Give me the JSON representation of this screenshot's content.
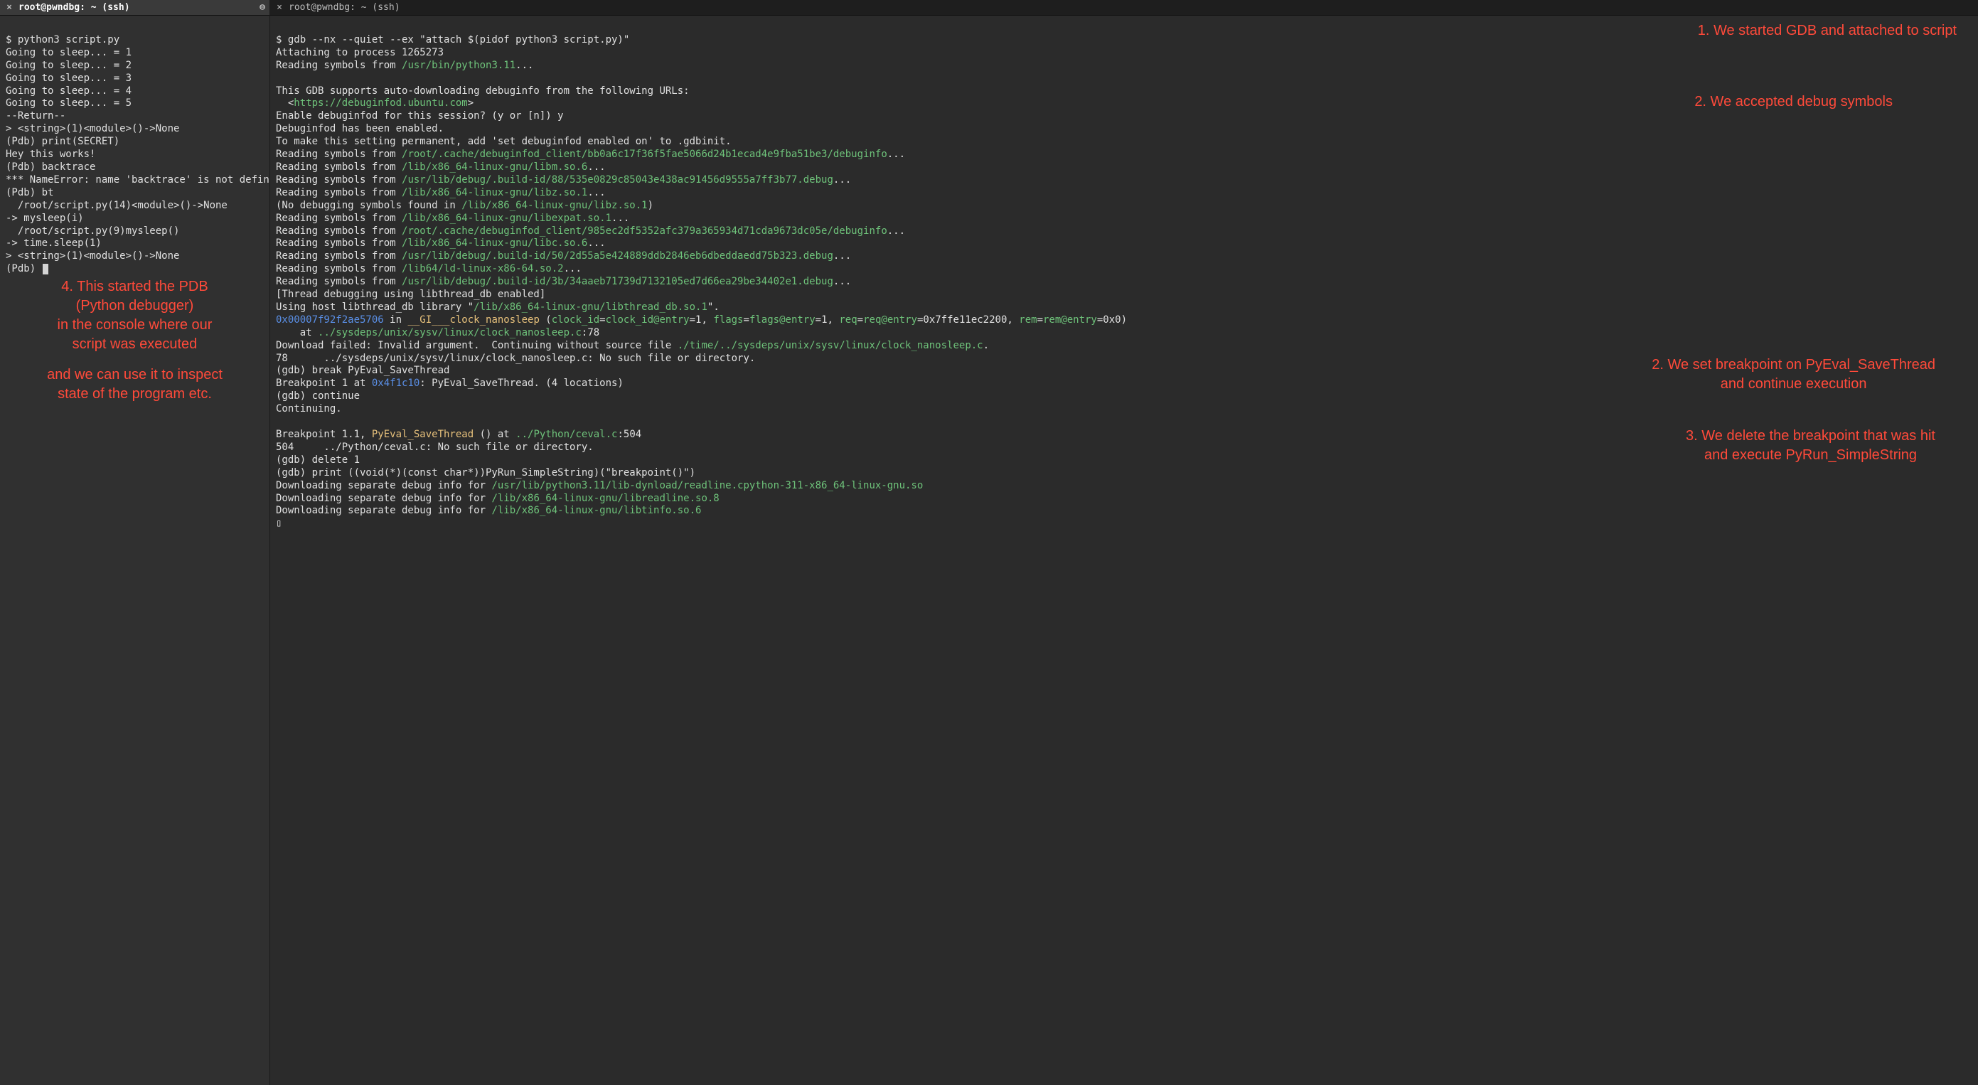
{
  "tabs": {
    "left": {
      "title": "root@pwndbg: ~ (ssh)",
      "close_glyph": "×",
      "extra_glyph": "⊖"
    },
    "right": {
      "title": "root@pwndbg: ~ (ssh)",
      "close_glyph": "×"
    }
  },
  "left_term": {
    "l01": "$ python3 script.py",
    "l02": "Going to sleep... = 1",
    "l03": "Going to sleep... = 2",
    "l04": "Going to sleep... = 3",
    "l05": "Going to sleep... = 4",
    "l06": "Going to sleep... = 5",
    "l07": "--Return--",
    "l08": "> <string>(1)<module>()->None",
    "l09": "(Pdb) print(SECRET)",
    "l10": "Hey this works!",
    "l11": "(Pdb) backtrace",
    "l12": "*** NameError: name 'backtrace' is not defined",
    "l13": "(Pdb) bt",
    "l14": "  /root/script.py(14)<module>()->None",
    "l15": "-> mysleep(i)",
    "l16": "  /root/script.py(9)mysleep()",
    "l17": "-> time.sleep(1)",
    "l18": "> <string>(1)<module>()->None",
    "l19": "(Pdb) "
  },
  "right_term": {
    "r01": "$ gdb --nx --quiet --ex \"attach $(pidof python3 script.py)\"",
    "r02": "Attaching to process 1265273",
    "r03a": "Reading symbols from ",
    "r03b": "/usr/bin/python3.11",
    "r03c": "...",
    "r04": "",
    "r05": "This GDB supports auto-downloading debuginfo from the following URLs:",
    "r06a": "  <",
    "r06b": "https://debuginfod.ubuntu.com",
    "r06c": ">",
    "r07": "Enable debuginfod for this session? (y or [n]) y",
    "r08": "Debuginfod has been enabled.",
    "r09": "To make this setting permanent, add 'set debuginfod enabled on' to .gdbinit.",
    "r10a": "Reading symbols from ",
    "r10b": "/root/.cache/debuginfod_client/bb0a6c17f36f5fae5066d24b1ecad4e9fba51be3/debuginfo",
    "r10c": "...",
    "r11a": "Reading symbols from ",
    "r11b": "/lib/x86_64-linux-gnu/libm.so.6",
    "r11c": "...",
    "r12a": "Reading symbols from ",
    "r12b": "/usr/lib/debug/.build-id/88/535e0829c85043e438ac91456d9555a7ff3b77.debug",
    "r12c": "...",
    "r13a": "Reading symbols from ",
    "r13b": "/lib/x86_64-linux-gnu/libz.so.1",
    "r13c": "...",
    "r14a": "(No debugging symbols found in ",
    "r14b": "/lib/x86_64-linux-gnu/libz.so.1",
    "r14c": ")",
    "r15a": "Reading symbols from ",
    "r15b": "/lib/x86_64-linux-gnu/libexpat.so.1",
    "r15c": "...",
    "r16a": "Reading symbols from ",
    "r16b": "/root/.cache/debuginfod_client/985ec2df5352afc379a365934d71cda9673dc05e/debuginfo",
    "r16c": "...",
    "r17a": "Reading symbols from ",
    "r17b": "/lib/x86_64-linux-gnu/libc.so.6",
    "r17c": "...",
    "r18a": "Reading symbols from ",
    "r18b": "/usr/lib/debug/.build-id/50/2d55a5e424889ddb2846eb6dbeddaedd75b323.debug",
    "r18c": "...",
    "r19a": "Reading symbols from ",
    "r19b": "/lib64/ld-linux-x86-64.so.2",
    "r19c": "...",
    "r20a": "Reading symbols from ",
    "r20b": "/usr/lib/debug/.build-id/3b/34aaeb71739d7132105ed7d66ea29be34402e1.debug",
    "r20c": "...",
    "r21": "[Thread debugging using libthread_db enabled]",
    "r22a": "Using host libthread_db library \"",
    "r22b": "/lib/x86_64-linux-gnu/libthread_db.so.1",
    "r22c": "\".",
    "r23addr": "0x00007f92f2ae5706",
    "r23in": " in ",
    "r23fn": "__GI___clock_nanosleep",
    "r23open": " (",
    "r23p1k": "clock_id",
    "r23eq": "=",
    "r23p1v": "clock_id@entry",
    "r23p1n": "=1, ",
    "r23p2k": "flags",
    "r23p2v": "flags@entry",
    "r23p2n": "=1, ",
    "r23p3k": "req",
    "r23p3v": "req@entry",
    "r23p3n": "=0x7ffe11ec2200, ",
    "r23p4k": "rem",
    "r23p4v": "rem@entry",
    "r23p4n": "=0x0)",
    "r24a": "    at ",
    "r24b": "../sysdeps/unix/sysv/linux/clock_nanosleep.c",
    "r24c": ":78",
    "r25a": "Download failed: Invalid argument.  Continuing without source file ",
    "r25b": "./time/../sysdeps/unix/sysv/linux/clock_nanosleep.c",
    "r25c": ".",
    "r26": "78      ../sysdeps/unix/sysv/linux/clock_nanosleep.c: No such file or directory.",
    "r27": "(gdb) break PyEval_SaveThread",
    "r28a": "Breakpoint 1 at ",
    "r28b": "0x4f1c10",
    "r28c": ": PyEval_SaveThread. (4 locations)",
    "r29": "(gdb) continue",
    "r30": "Continuing.",
    "r31": "",
    "r32a": "Breakpoint 1.1, ",
    "r32b": "PyEval_SaveThread",
    "r32c": " () at ",
    "r32d": "../Python/ceval.c",
    "r32e": ":504",
    "r33": "504     ../Python/ceval.c: No such file or directory.",
    "r34": "(gdb) delete 1",
    "r35": "(gdb) print ((void(*)(const char*))PyRun_SimpleString)(\"breakpoint()\")",
    "r36a": "Downloading separate debug info for ",
    "r36b": "/usr/lib/python3.11/lib-dynload/readline.cpython-311-x86_64-linux-gnu.so",
    "r37a": "Downloading separate debug info for ",
    "r37b": "/lib/x86_64-linux-gnu/libreadline.so.8",
    "r38a": "Downloading separate debug info for ",
    "r38b": "/lib/x86_64-linux-gnu/libtinfo.so.6",
    "r39": "▯"
  },
  "annotations": {
    "a1": "1. We started GDB and attached to script",
    "a2": "2. We accepted debug symbols",
    "a3a": "2. We set breakpoint on PyEval_SaveThread",
    "a3b": "and continue execution",
    "a4a": "3. We delete the breakpoint that was hit",
    "a4b": "and execute PyRun_SimpleString",
    "a5a": "4. This started the PDB",
    "a5b": "(Python debugger)",
    "a5c": "in the console where our",
    "a5d": "script was executed",
    "a6a": "and we can use it to inspect",
    "a6b": "state of the program etc."
  }
}
